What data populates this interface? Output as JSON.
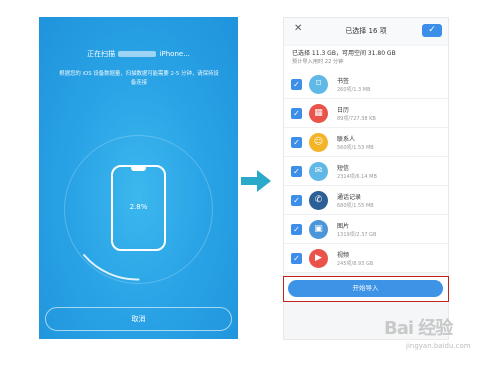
{
  "scan_screen": {
    "title_prefix": "正在扫描",
    "title_suffix": "iPhone...",
    "description": "根据您的 iOS 设备数据量，扫描数据可能需要 2-5 分钟，请保持设备连接",
    "progress_text": "2.8%",
    "progress": 0.028,
    "cancel_label": "取消",
    "bg_color": "#2aa4e6"
  },
  "arrow": {
    "color": "#2aa9c9",
    "icon": "arrow-right-icon"
  },
  "list_screen": {
    "close_label": "✕",
    "title": "已选择 16 项",
    "confirm_label": "✓",
    "summary_line1": "已选择 11.3 GB，可用空间 31.80 GB",
    "summary_line2": "预计导入用时 22 分钟",
    "items": [
      {
        "name": "书签",
        "size": "260项/1.3 MB",
        "icon": "bookmark-icon",
        "color": "#5fb8e6",
        "glyph": "⌑"
      },
      {
        "name": "日历",
        "size": "89项/727.38 KB",
        "icon": "calendar-icon",
        "color": "#e9534a",
        "glyph": "▦"
      },
      {
        "name": "联系人",
        "size": "560项/1.53 MB",
        "icon": "contacts-icon",
        "color": "#f3b428",
        "glyph": "☺"
      },
      {
        "name": "短信",
        "size": "2314项/6.14 MB",
        "icon": "messages-icon",
        "color": "#5fb8e6",
        "glyph": "✉"
      },
      {
        "name": "通话记录",
        "size": "680项/1.55 MB",
        "icon": "call-log-icon",
        "color": "#2b5f95",
        "glyph": "✆"
      },
      {
        "name": "图片",
        "size": "1319项/2.37 GB",
        "icon": "photos-icon",
        "color": "#4a96d8",
        "glyph": "▣"
      },
      {
        "name": "视频",
        "size": "245项/8.93 GB",
        "icon": "video-icon",
        "color": "#e9534a",
        "glyph": "▶"
      }
    ],
    "import_label": "开始导入",
    "highlight_color": "#c3251d",
    "accent_color": "#3d8ee8"
  },
  "watermark": {
    "brand": "Bai 经验",
    "url": "jingyan.baidu.com"
  }
}
